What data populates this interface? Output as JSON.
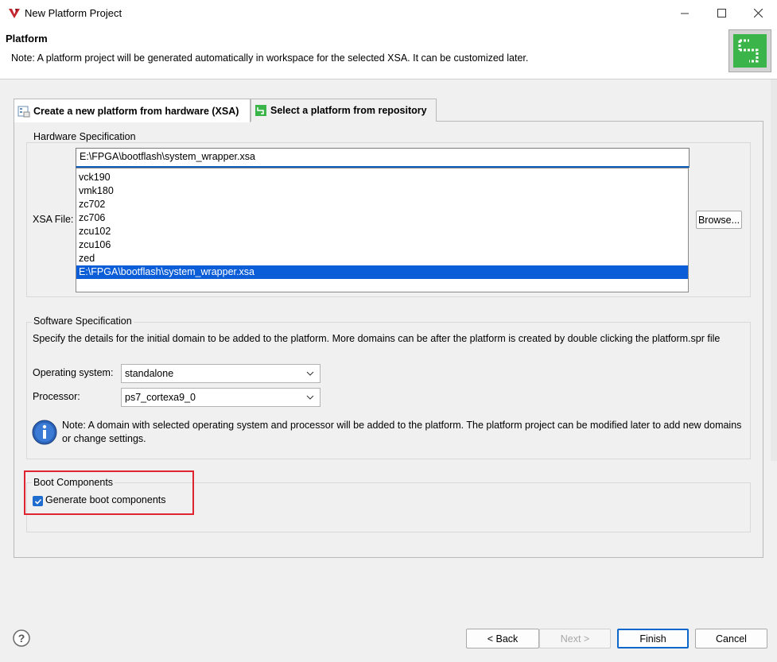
{
  "window": {
    "title": "New Platform Project",
    "icons": {
      "app": "vitis-logo-icon",
      "minimize": "minimize-icon",
      "maximize": "maximize-icon",
      "close": "close-icon"
    }
  },
  "header": {
    "title": "Platform",
    "description": "Note: A platform project will be generated automatically in workspace for the selected XSA. It can be customized later.",
    "icon": "platform-wizard-icon"
  },
  "tabs": [
    {
      "label": "Create a new platform from hardware (XSA)",
      "active": true,
      "icon": "hardware-tab-icon"
    },
    {
      "label": "Select a platform from repository",
      "active": false,
      "icon": "repository-tab-icon"
    }
  ],
  "hardware": {
    "group_label": "Hardware Specification",
    "xsa_label": "XSA File:",
    "xsa_value": "E:\\FPGA\\bootflash\\system_wrapper.xsa",
    "options": [
      "vck190",
      "vmk180",
      "zc702",
      "zc706",
      "zcu102",
      "zcu106",
      "zed",
      "E:\\FPGA\\bootflash\\system_wrapper.xsa"
    ],
    "selected_index": 7,
    "browse_label": "Browse..."
  },
  "software": {
    "group_label": "Software Specification",
    "description": "Specify the details for the initial domain to be added to the platform. More domains can be after the platform is created by double clicking the platform.spr file",
    "os_label": "Operating system:",
    "os_value": "standalone",
    "processor_label": "Processor:",
    "processor_value": "ps7_cortexa9_0",
    "note": "Note: A domain with selected operating system and processor will be added to the platform. The platform project can be modified later to add new domains or change settings.",
    "note_icon": "info-icon"
  },
  "boot": {
    "group_label": "Boot Components",
    "checkbox_label": "Generate boot components",
    "checked": true,
    "highlight_color": "#e0242f"
  },
  "footer": {
    "help_icon": "help-icon",
    "back_label": "< Back",
    "next_label": "Next >",
    "finish_label": "Finish",
    "cancel_label": "Cancel"
  },
  "colors": {
    "accent": "#0b5ed7",
    "selection": "#0b5ed7",
    "highlight": "#e0242f"
  }
}
